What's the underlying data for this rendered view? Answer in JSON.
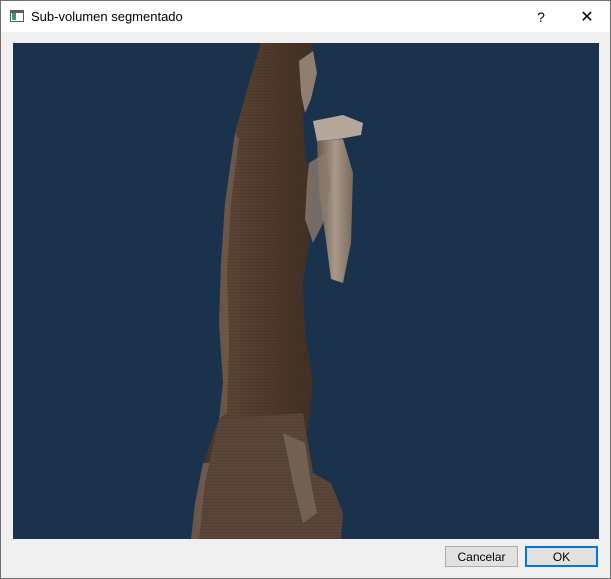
{
  "window": {
    "title": "Sub-volumen segmentado",
    "help_label": "?",
    "close_label": "✕"
  },
  "viewport": {
    "background_color": "#1b324d",
    "model_color": "#4d3a2c"
  },
  "buttons": {
    "cancel_label": "Cancelar",
    "ok_label": "OK",
    "default_accent": "#0078d7"
  }
}
